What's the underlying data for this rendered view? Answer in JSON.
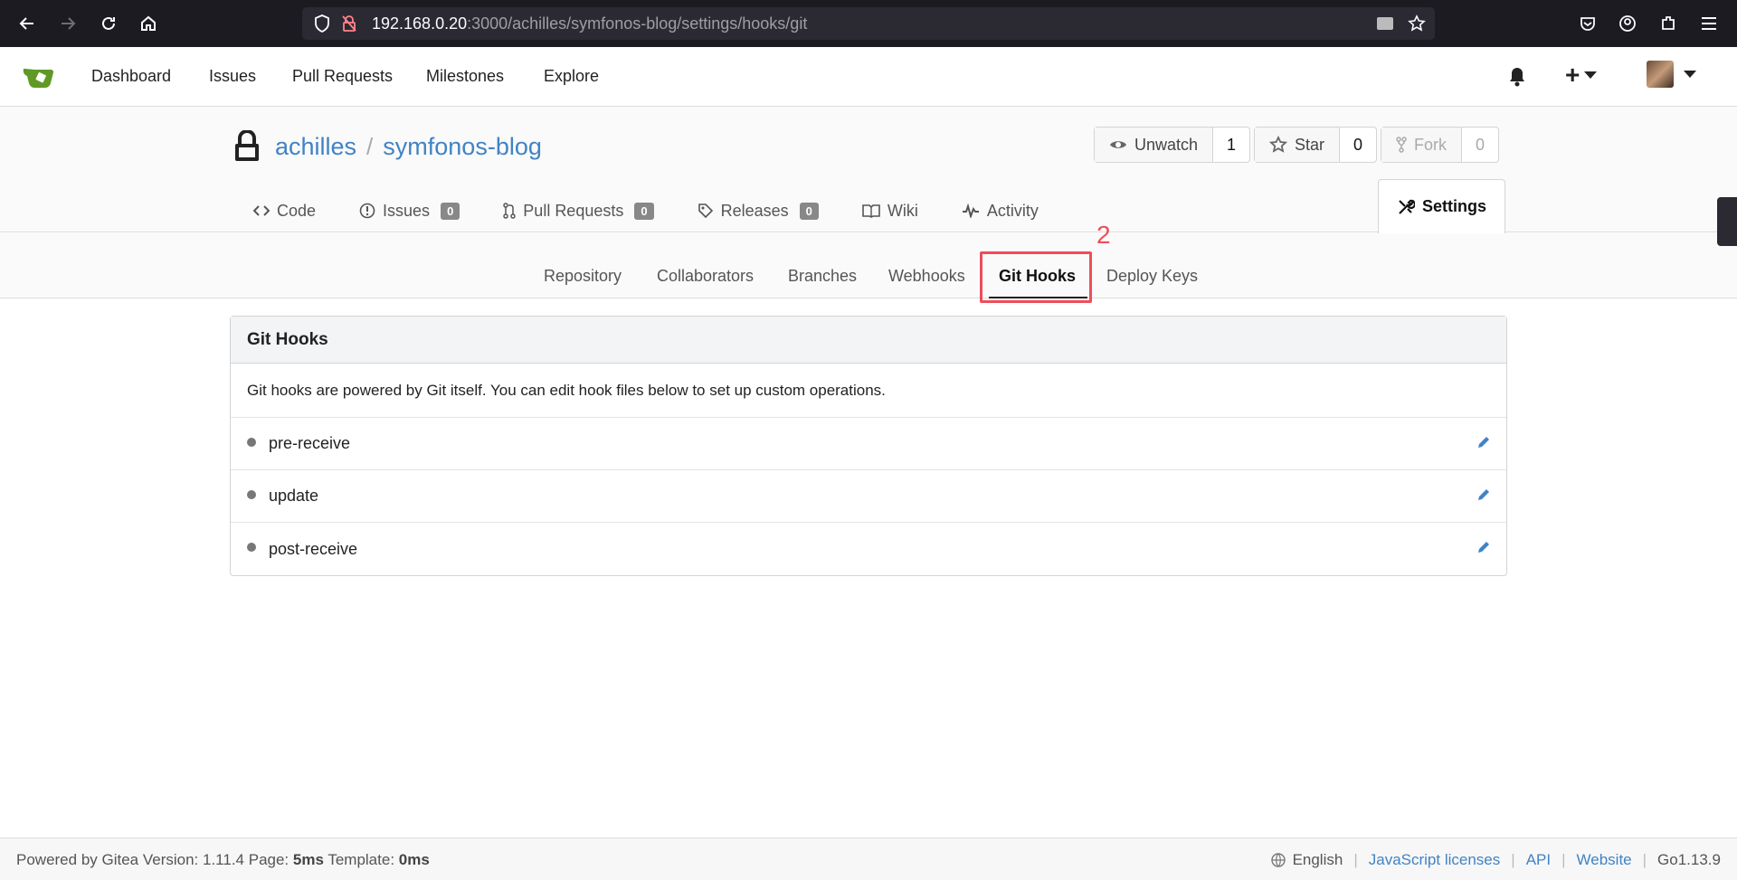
{
  "browser": {
    "url_host": "192.168.0.20",
    "url_rest": ":3000/achilles/symfonos-blog/settings/hooks/git"
  },
  "topnav": {
    "items": [
      "Dashboard",
      "Issues",
      "Pull Requests",
      "Milestones",
      "Explore"
    ],
    "plus": "+"
  },
  "repo": {
    "owner": "achilles",
    "separator": "/",
    "name": "symfonos-blog",
    "unwatch_label": "Unwatch",
    "watch_count": "1",
    "star_label": "Star",
    "star_count": "0",
    "fork_label": "Fork",
    "fork_count": "0"
  },
  "repo_tabs": {
    "code": "Code",
    "issues": "Issues",
    "issues_count": "0",
    "pulls": "Pull Requests",
    "pulls_count": "0",
    "releases": "Releases",
    "releases_count": "0",
    "wiki": "Wiki",
    "activity": "Activity",
    "settings": "Settings"
  },
  "settings_menu": {
    "repository": "Repository",
    "collaborators": "Collaborators",
    "branches": "Branches",
    "webhooks": "Webhooks",
    "git_hooks": "Git Hooks",
    "deploy_keys": "Deploy Keys",
    "annotation": "2"
  },
  "panel": {
    "title": "Git Hooks",
    "description": "Git hooks are powered by Git itself. You can edit hook files below to set up custom operations.",
    "hooks": [
      "pre-receive",
      "update",
      "post-receive"
    ]
  },
  "footer": {
    "powered": "Powered by Gitea Version: 1.11.4 Page: ",
    "page_time": "5ms",
    "template_label": " Template: ",
    "template_time": "0ms",
    "language": "English",
    "js_licenses": "JavaScript licenses",
    "api": "API",
    "website": "Website",
    "go_version": "Go1.13.9"
  },
  "colors": {
    "link": "#4183c4",
    "highlight": "#ef4d5a",
    "browser_bg": "#1c1b22"
  }
}
